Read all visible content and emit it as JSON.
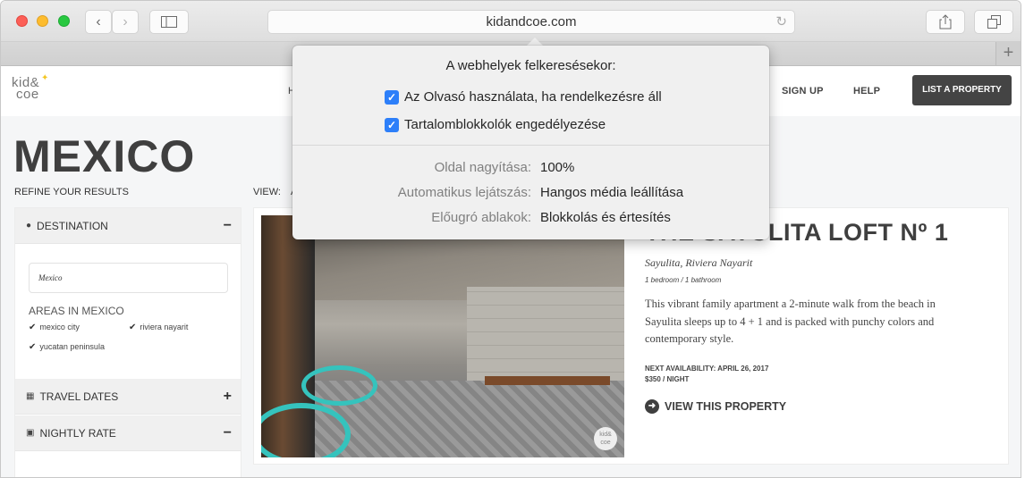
{
  "browser": {
    "url": "kidandcoe.com",
    "new_tab_label": "+"
  },
  "site": {
    "logo_line1": "kid&",
    "logo_line2": "coe",
    "nav_partial": "H",
    "nav": [
      {
        "label": "SIGN UP"
      },
      {
        "label": "HELP"
      }
    ],
    "list_property_label": "LIST A PROPERTY"
  },
  "page": {
    "heading": "MEXICO",
    "refine_label": "REFINE YOUR RESULTS",
    "view_label": "VIEW:",
    "view_value_partial": "A"
  },
  "sidebar": {
    "destination": {
      "label": "DESTINATION",
      "toggle": "−",
      "input_value": "Mexico",
      "areas_title": "AREAS IN MEXICO",
      "areas": [
        {
          "label": "mexico city",
          "checked": true
        },
        {
          "label": "riviera nayarit",
          "checked": true
        },
        {
          "label": "yucatan peninsula",
          "checked": true
        }
      ]
    },
    "travel_dates": {
      "label": "TRAVEL DATES",
      "toggle": "+"
    },
    "nightly_rate": {
      "label": "NIGHTLY RATE",
      "toggle": "−"
    }
  },
  "listing": {
    "title": "THE SAYULITA LOFT Nº 1",
    "location": "Sayulita, Riviera Nayarit",
    "rooms": "1 bedroom / 1 bathroom",
    "description": "This vibrant family apartment a 2-minute walk from the beach in Sayulita sleeps up to 4 + 1 and is packed with punchy colors and contemporary style.",
    "availability": "NEXT AVAILABILITY: APRIL 26, 2017",
    "price": "$350 / NIGHT",
    "view_link": "VIEW THIS PROPERTY",
    "photo_badge": "kid& coe"
  },
  "popover": {
    "title": "A webhelyek felkeresésekor:",
    "checkboxes": [
      {
        "label": "Az Olvasó használata, ha rendelkezésre áll",
        "checked": true
      },
      {
        "label": "Tartalomblokkolók engedélyezése",
        "checked": true
      }
    ],
    "settings": [
      {
        "label": "Oldal nagyítása:",
        "value": "100%"
      },
      {
        "label": "Automatikus lejátszás:",
        "value": "Hangos média leállítása"
      },
      {
        "label": "Előugró ablakok:",
        "value": "Blokkolás és értesítés"
      }
    ],
    "accent_color": "#2d7ff9"
  }
}
